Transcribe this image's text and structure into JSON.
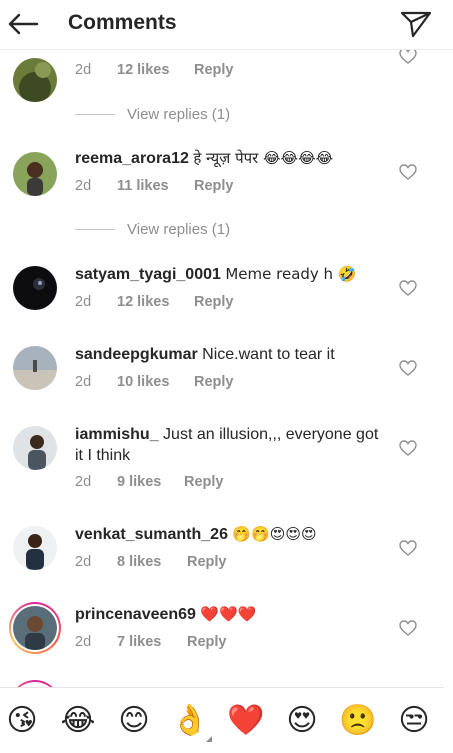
{
  "header": {
    "title": "Comments"
  },
  "comments": [
    {
      "username": "",
      "text": "",
      "time": "2d",
      "likes": "12 likes",
      "reply": "Reply",
      "view_replies": "View replies (1)"
    },
    {
      "username": "reema_arora12",
      "text": "हे न्यूज़ पेपर 😂😂😂😂",
      "time": "2d",
      "likes": "11 likes",
      "reply": "Reply",
      "view_replies": "View replies (1)"
    },
    {
      "username": "satyam_tyagi_0001",
      "text": "Meme ready h 🤣",
      "time": "2d",
      "likes": "12 likes",
      "reply": "Reply"
    },
    {
      "username": "sandeepgkumar",
      "text": "Nice.want to tear it",
      "time": "2d",
      "likes": "10 likes",
      "reply": "Reply"
    },
    {
      "username": "iammishu_",
      "text": "Just an illusion,,, everyone got it I think",
      "time": "2d",
      "likes": "9 likes",
      "reply": "Reply"
    },
    {
      "username": "venkat_sumanth_26",
      "text": "🤭🤭😍😍😍",
      "time": "2d",
      "likes": "8 likes",
      "reply": "Reply"
    },
    {
      "username": "princenaveen69",
      "text": "❤️❤️❤️",
      "time": "2d",
      "likes": "7 likes",
      "reply": "Reply"
    }
  ],
  "emoji_bar": [
    "😘",
    "😂",
    "😊",
    "👌",
    "❤️",
    "😍",
    "🙁",
    "😒"
  ],
  "colors": {
    "text": "#262626",
    "muted": "#8e8e8e",
    "story_ring": "#d6249f"
  },
  "icons": {
    "back": "arrow-left-icon",
    "send": "paper-plane-icon",
    "like": "heart-outline-icon"
  }
}
